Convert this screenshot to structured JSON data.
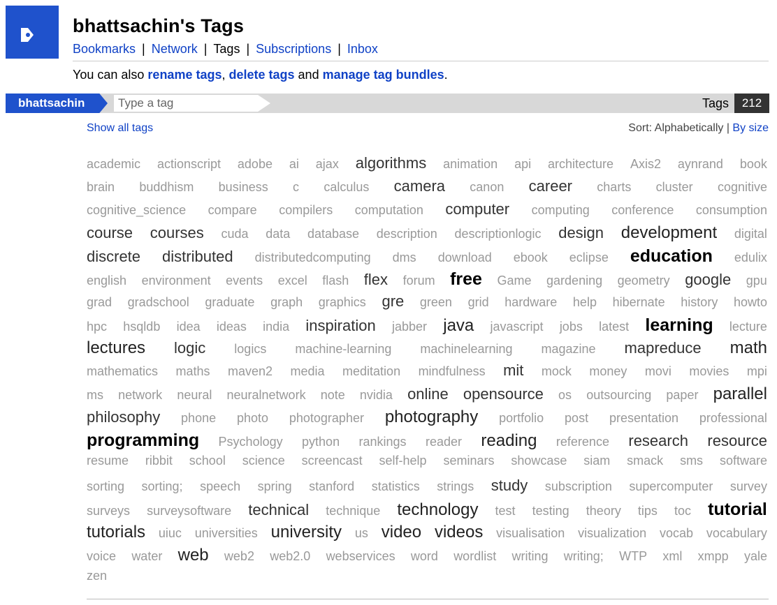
{
  "header": {
    "title": "bhattsachin's Tags",
    "nav": [
      {
        "label": "Bookmarks",
        "current": false
      },
      {
        "label": "Network",
        "current": false
      },
      {
        "label": "Tags",
        "current": true
      },
      {
        "label": "Subscriptions",
        "current": false
      },
      {
        "label": "Inbox",
        "current": false
      }
    ],
    "also_prefix": "You can also ",
    "rename_link": "rename tags",
    "comma": ", ",
    "delete_link": "delete tags",
    "and_text": " and ",
    "bundles_link": "manage tag bundles",
    "period": "."
  },
  "tagbar": {
    "user": "bhattsachin",
    "placeholder": "Type a tag",
    "tags_label": "Tags",
    "count": "212"
  },
  "controls": {
    "show_all": "Show all tags",
    "sort_label": "Sort: Alphabetically",
    "sort_sep": " | ",
    "sort_by_size": "By size"
  },
  "cloud": {
    "rows": [
      [
        [
          "academic",
          1
        ],
        [
          "actionscript",
          1
        ],
        [
          "adobe",
          1
        ],
        [
          "ai",
          1
        ],
        [
          "ajax",
          1
        ],
        [
          "algorithms",
          2
        ],
        [
          "animation",
          1
        ],
        [
          "api",
          1
        ],
        [
          "architecture",
          1
        ],
        [
          "Axis2",
          1
        ],
        [
          "aynrand",
          1
        ],
        [
          "book",
          1
        ]
      ],
      [
        [
          "brain",
          1
        ],
        [
          "buddhism",
          1
        ],
        [
          "business",
          1
        ],
        [
          "c",
          1
        ],
        [
          "calculus",
          1
        ],
        [
          "camera",
          2
        ],
        [
          "canon",
          1
        ],
        [
          "career",
          2
        ],
        [
          "charts",
          1
        ],
        [
          "cluster",
          1
        ],
        [
          "cognitive",
          1
        ]
      ],
      [
        [
          "cognitive_science",
          1
        ],
        [
          "compare",
          1
        ],
        [
          "compilers",
          1
        ],
        [
          "computation",
          1
        ],
        [
          "computer",
          2
        ],
        [
          "computing",
          1
        ],
        [
          "conference",
          1
        ],
        [
          "consumption",
          1
        ]
      ],
      [
        [
          "course",
          2
        ],
        [
          "courses",
          2
        ],
        [
          "cuda",
          1
        ],
        [
          "data",
          1
        ],
        [
          "database",
          1
        ],
        [
          "description",
          1
        ],
        [
          "descriptionlogic",
          1
        ],
        [
          "design",
          2
        ],
        [
          "development",
          3
        ],
        [
          "digital",
          1
        ]
      ],
      [
        [
          "discrete",
          2
        ],
        [
          "distributed",
          2
        ],
        [
          "distributedcomputing",
          1
        ],
        [
          "dms",
          1
        ],
        [
          "download",
          1
        ],
        [
          "ebook",
          1
        ],
        [
          "eclipse",
          1
        ],
        [
          "education",
          4
        ],
        [
          "edulix",
          1
        ]
      ],
      [
        [
          "english",
          1
        ],
        [
          "environment",
          1
        ],
        [
          "events",
          1
        ],
        [
          "excel",
          1
        ],
        [
          "flash",
          1
        ],
        [
          "flex",
          2
        ],
        [
          "forum",
          1
        ],
        [
          "free",
          4
        ],
        [
          "Game",
          1
        ],
        [
          "gardening",
          1
        ],
        [
          "geometry",
          1
        ],
        [
          "google",
          2
        ],
        [
          "gpu",
          1
        ]
      ],
      [
        [
          "grad",
          1
        ],
        [
          "gradschool",
          1
        ],
        [
          "graduate",
          1
        ],
        [
          "graph",
          1
        ],
        [
          "graphics",
          1
        ],
        [
          "gre",
          2
        ],
        [
          "green",
          1
        ],
        [
          "grid",
          1
        ],
        [
          "hardware",
          1
        ],
        [
          "help",
          1
        ],
        [
          "hibernate",
          1
        ],
        [
          "history",
          1
        ],
        [
          "howto",
          1
        ]
      ],
      [
        [
          "hpc",
          1
        ],
        [
          "hsqldb",
          1
        ],
        [
          "idea",
          1
        ],
        [
          "ideas",
          1
        ],
        [
          "india",
          1
        ],
        [
          "inspiration",
          2
        ],
        [
          "jabber",
          1
        ],
        [
          "java",
          3
        ],
        [
          "javascript",
          1
        ],
        [
          "jobs",
          1
        ],
        [
          "latest",
          1
        ],
        [
          "learning",
          4
        ],
        [
          "lecture",
          1
        ]
      ],
      [
        [
          "lectures",
          3
        ],
        [
          "logic",
          2
        ],
        [
          "logics",
          1
        ],
        [
          "machine-learning",
          1
        ],
        [
          "machinelearning",
          1
        ],
        [
          "magazine",
          1
        ],
        [
          "mapreduce",
          2
        ],
        [
          "math",
          3
        ]
      ],
      [
        [
          "mathematics",
          1
        ],
        [
          "maths",
          1
        ],
        [
          "maven2",
          1
        ],
        [
          "media",
          1
        ],
        [
          "meditation",
          1
        ],
        [
          "mindfulness",
          1
        ],
        [
          "mit",
          2
        ],
        [
          "mock",
          1
        ],
        [
          "money",
          1
        ],
        [
          "movi",
          1
        ],
        [
          "movies",
          1
        ],
        [
          "mpi",
          1
        ]
      ],
      [
        [
          "ms",
          1
        ],
        [
          "network",
          1
        ],
        [
          "neural",
          1
        ],
        [
          "neuralnetwork",
          1
        ],
        [
          "note",
          1
        ],
        [
          "nvidia",
          1
        ],
        [
          "online",
          2
        ],
        [
          "opensource",
          2
        ],
        [
          "os",
          1
        ],
        [
          "outsourcing",
          1
        ],
        [
          "paper",
          1
        ],
        [
          "parallel",
          3
        ]
      ],
      [
        [
          "philosophy",
          2
        ],
        [
          "phone",
          1
        ],
        [
          "photo",
          1
        ],
        [
          "photographer",
          1
        ],
        [
          "photography",
          3
        ],
        [
          "portfolio",
          1
        ],
        [
          "post",
          1
        ],
        [
          "presentation",
          1
        ],
        [
          "professional",
          1
        ]
      ],
      [
        [
          "programming",
          4
        ],
        [
          "Psychology",
          1
        ],
        [
          "python",
          1
        ],
        [
          "rankings",
          1
        ],
        [
          "reader",
          1
        ],
        [
          "reading",
          3
        ],
        [
          "reference",
          1
        ],
        [
          "research",
          2
        ],
        [
          "resource",
          2
        ]
      ],
      [
        [
          "resume",
          1
        ],
        [
          "ribbit",
          1
        ],
        [
          "school",
          1
        ],
        [
          "science",
          1
        ],
        [
          "screencast",
          1
        ],
        [
          "self-help",
          1
        ],
        [
          "seminars",
          1
        ],
        [
          "showcase",
          1
        ],
        [
          "siam",
          1
        ],
        [
          "smack",
          1
        ],
        [
          "sms",
          1
        ],
        [
          "software",
          1
        ]
      ],
      [
        [
          "sorting",
          1
        ],
        [
          "sorting;",
          1
        ],
        [
          "speech",
          1
        ],
        [
          "spring",
          1
        ],
        [
          "stanford",
          1
        ],
        [
          "statistics",
          1
        ],
        [
          "strings",
          1
        ],
        [
          "study",
          2
        ],
        [
          "subscription",
          1
        ],
        [
          "supercomputer",
          1
        ],
        [
          "survey",
          1
        ]
      ],
      [
        [
          "surveys",
          1
        ],
        [
          "surveysoftware",
          1
        ],
        [
          "technical",
          2
        ],
        [
          "technique",
          1
        ],
        [
          "technology",
          3
        ],
        [
          "test",
          1
        ],
        [
          "testing",
          1
        ],
        [
          "theory",
          1
        ],
        [
          "tips",
          1
        ],
        [
          "toc",
          1
        ],
        [
          "tutorial",
          4
        ]
      ],
      [
        [
          "tutorials",
          3
        ],
        [
          "uiuc",
          1
        ],
        [
          "universities",
          1
        ],
        [
          "university",
          3
        ],
        [
          "us",
          1
        ],
        [
          "video",
          3
        ],
        [
          "videos",
          3
        ],
        [
          "visualisation",
          1
        ],
        [
          "visualization",
          1
        ],
        [
          "vocab",
          1
        ],
        [
          "vocabulary",
          1
        ]
      ],
      [
        [
          "voice",
          1
        ],
        [
          "water",
          1
        ],
        [
          "web",
          3
        ],
        [
          "web2",
          1
        ],
        [
          "web2.0",
          1
        ],
        [
          "webservices",
          1
        ],
        [
          "word",
          1
        ],
        [
          "wordlist",
          1
        ],
        [
          "writing",
          1
        ],
        [
          "writing;",
          1
        ],
        [
          "WTP",
          1
        ],
        [
          "xml",
          1
        ],
        [
          "xmpp",
          1
        ],
        [
          "yale",
          1
        ]
      ],
      [
        [
          "zen",
          1
        ]
      ]
    ]
  },
  "colors": {
    "brand_blue": "#1f52cc",
    "link_blue": "#1042c6",
    "bar_gray": "#d8d8d8",
    "count_bg": "#333333"
  }
}
